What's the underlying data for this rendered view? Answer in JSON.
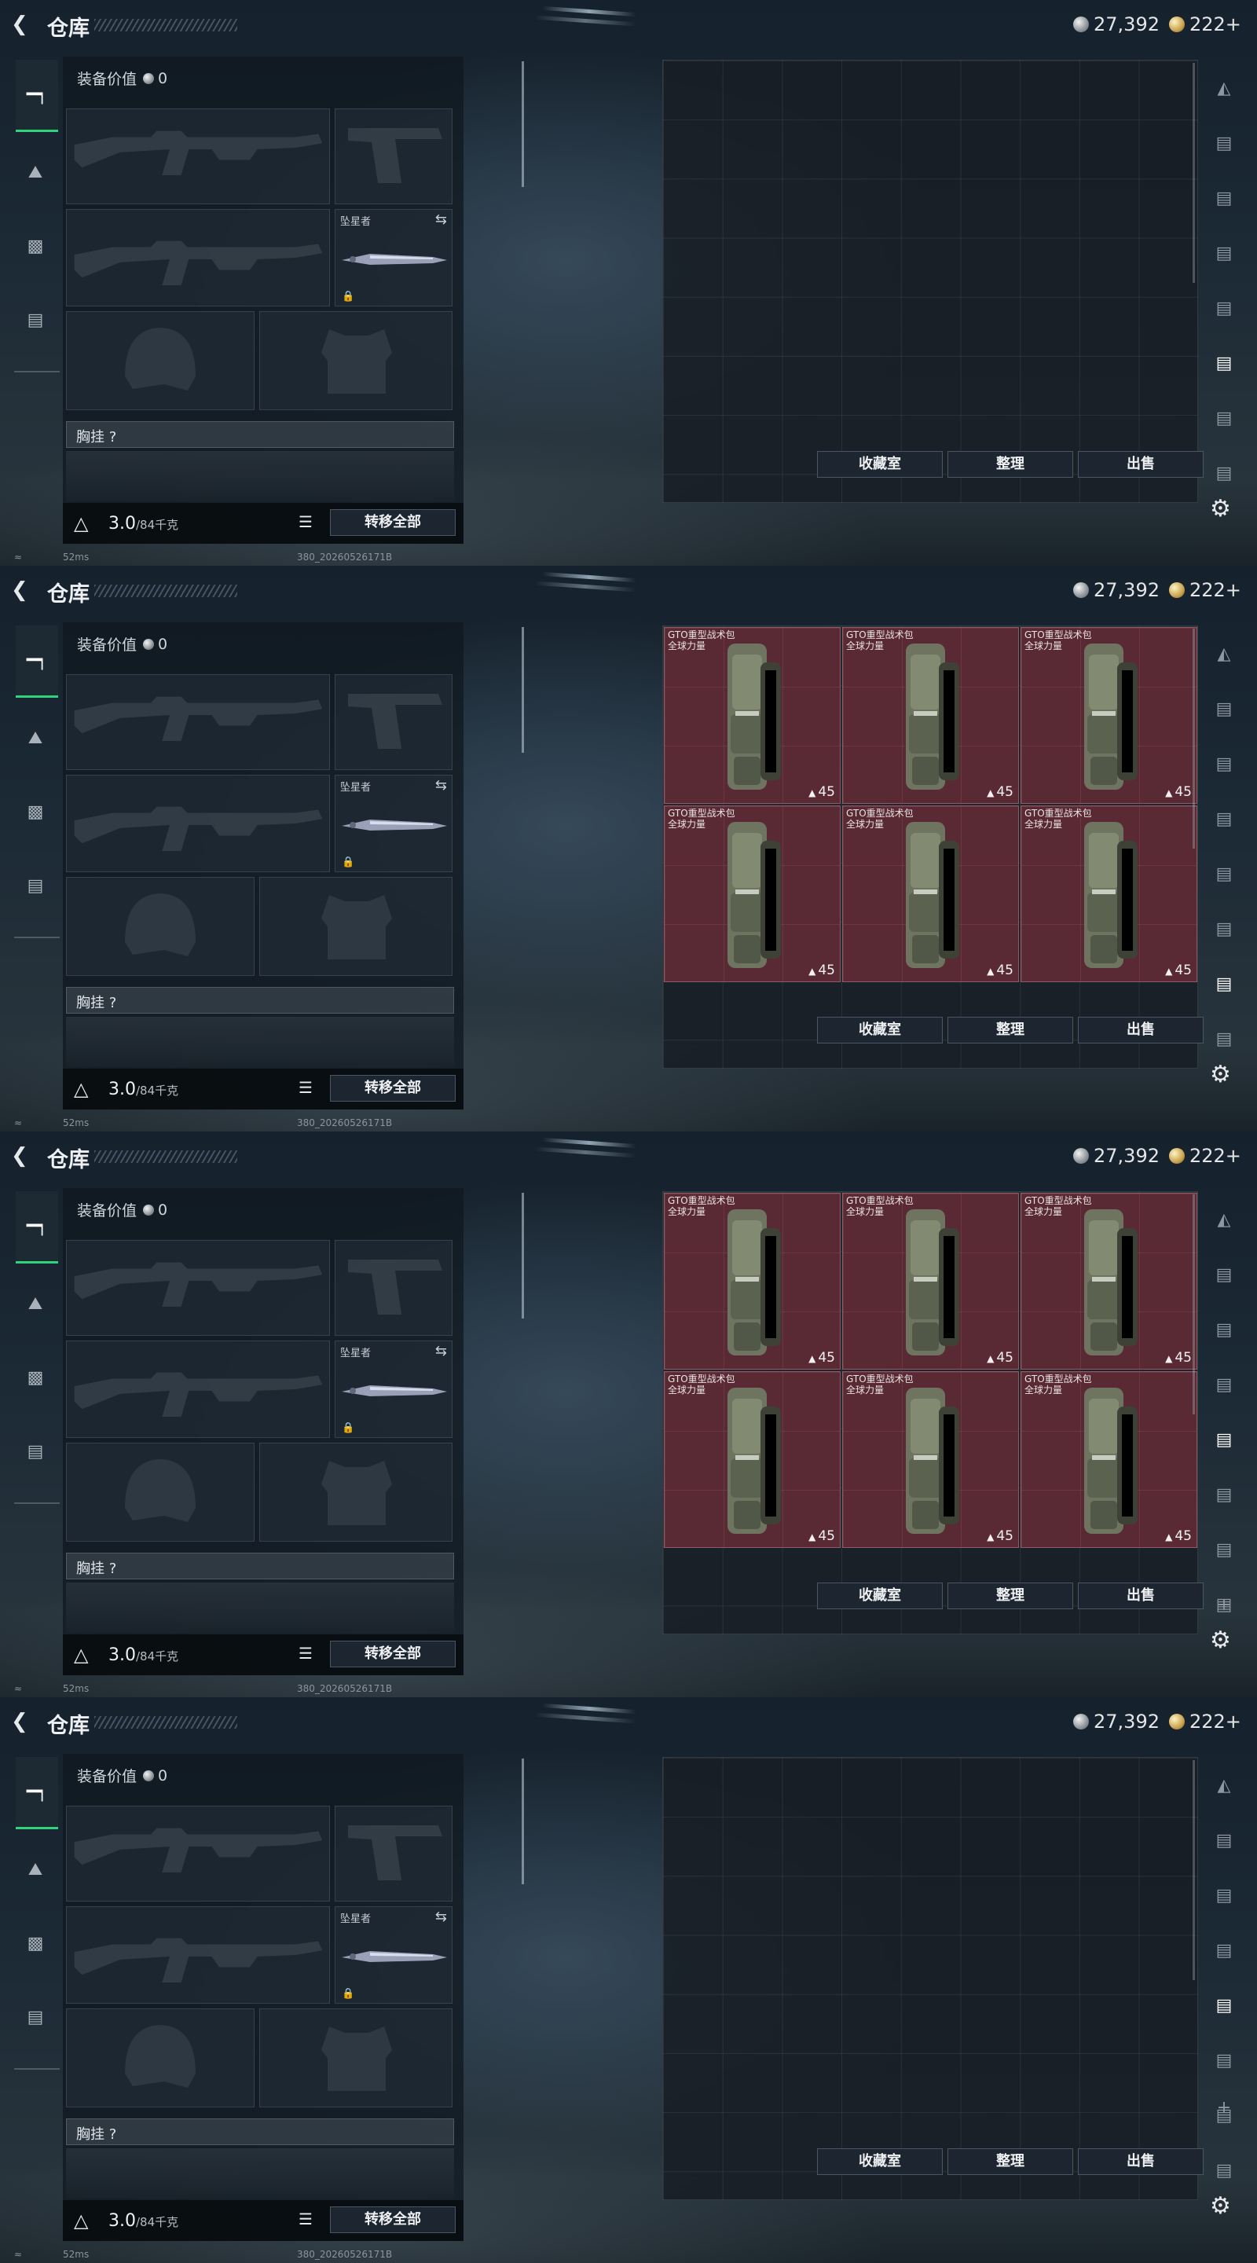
{
  "header": {
    "title": "仓库",
    "silver_amount": "27,392",
    "gold_amount": "222+"
  },
  "equipment": {
    "value_label": "装备价值",
    "value": "0",
    "melee_label": "坠星者",
    "vest_label": "胸挂 ?",
    "weight_value": "3.0",
    "weight_capacity": "/84千克",
    "transfer_all_label": "转移全部"
  },
  "stash": {
    "collection_label": "收藏室",
    "sort_label": "整理",
    "sell_label": "出售"
  },
  "items": {
    "name_line1": "GTO重型战术包",
    "name_line2": "全球力量",
    "count": "45"
  },
  "status": {
    "ping": "52ms",
    "build": "380_20260526171B"
  },
  "screens": [
    {
      "id": "screen-1",
      "stash_state": "empty",
      "active_rail": 5
    },
    {
      "id": "screen-2",
      "stash_state": "6 items",
      "active_rail": 6
    },
    {
      "id": "screen-3",
      "stash_state": "6 items",
      "active_rail": 4
    },
    {
      "id": "screen-4",
      "stash_state": "empty",
      "active_rail": 4
    }
  ],
  "colors": {
    "accent_green": "#2fd47b",
    "item_highlight": "#5a2a34"
  }
}
